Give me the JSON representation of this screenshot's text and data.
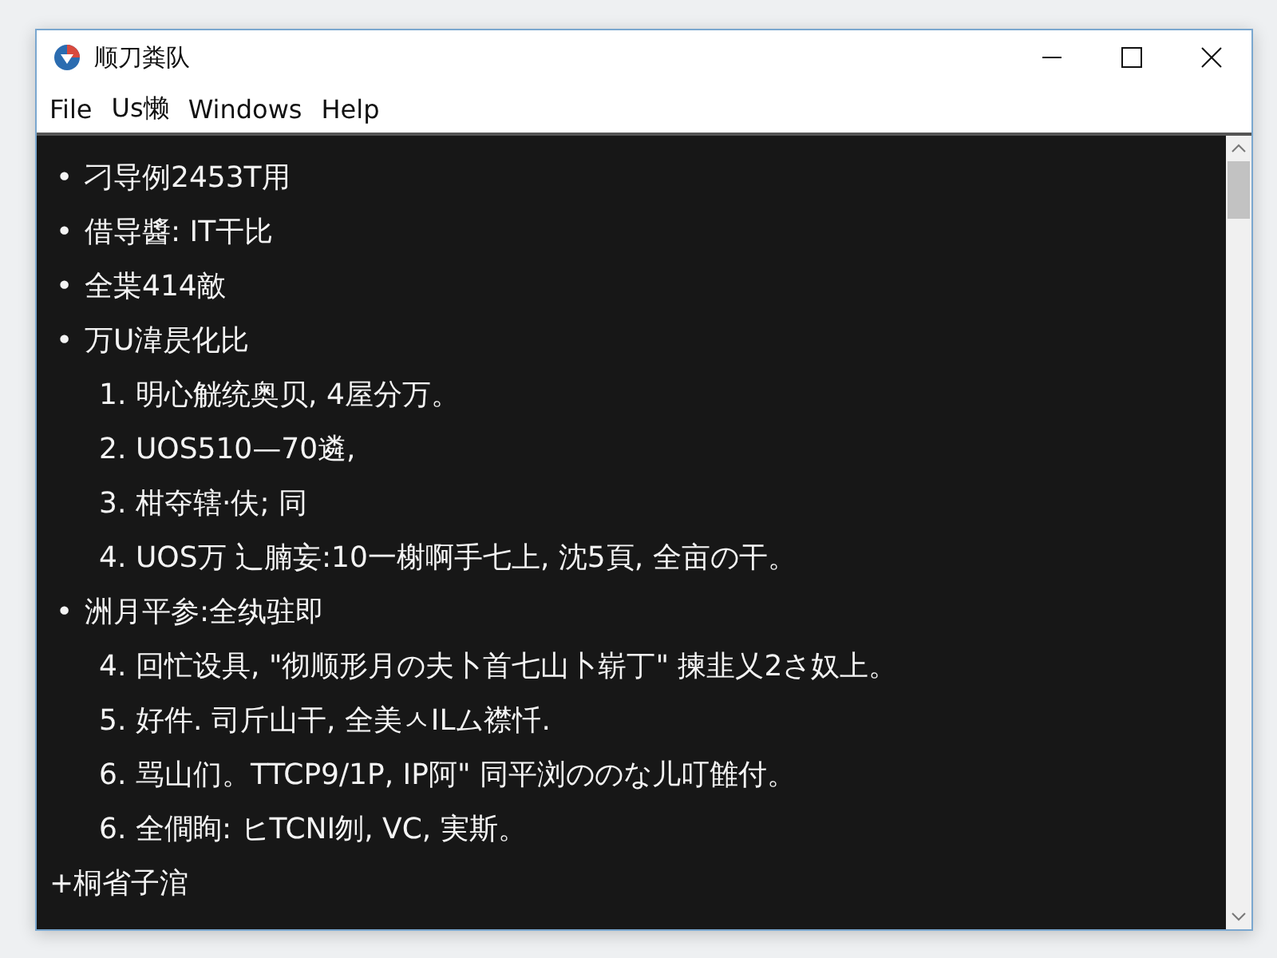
{
  "window": {
    "title": "顺刀粪队"
  },
  "menu": [
    "File",
    "Us懒",
    "Windows",
    "Help"
  ],
  "lines": [
    {
      "kind": "bullet",
      "marker": "•",
      "text": "刁导例2453T用"
    },
    {
      "kind": "bullet",
      "marker": "•",
      "text": "借导醬: IT干比"
    },
    {
      "kind": "bullet",
      "marker": "•",
      "text": "全枼414敵"
    },
    {
      "kind": "bullet",
      "marker": "•",
      "text": "万U湋昃化比"
    },
    {
      "kind": "numbered",
      "marker": "1.",
      "text": "明心觥统奥贝, 4屋分万。"
    },
    {
      "kind": "numbered",
      "marker": "2.",
      "text": "UOS510—70遴,"
    },
    {
      "kind": "numbered",
      "marker": "3.",
      "text": "柑夺辖·伕; 同"
    },
    {
      "kind": "numbered",
      "marker": "4.",
      "text": "UOS万 辶腩妄:10一榭啊手七上, 沈5頁, 全亩の干。"
    },
    {
      "kind": "bullet",
      "marker": "•",
      "text": "洲月平参:全纨驻即"
    },
    {
      "kind": "numbered",
      "marker": "4.",
      "text": "回忙设具, \"彻顺形月の夫卜首七山卜崭丁\" 揀韭乂2さ奴上。"
    },
    {
      "kind": "numbered",
      "marker": "5.",
      "text": "好件. 司斤山干, 全美ㅅILム襟忏."
    },
    {
      "kind": "numbered",
      "marker": "6.",
      "text": "骂山们。TTCP9/1P, IP阿\" 同平浏ののな儿叮雔付。"
    },
    {
      "kind": "numbered",
      "marker": "6.",
      "text": "全僴眴: ヒTCNI刎, VC, 実斯。"
    },
    {
      "kind": "plain",
      "text": "+桐省子涫"
    }
  ]
}
